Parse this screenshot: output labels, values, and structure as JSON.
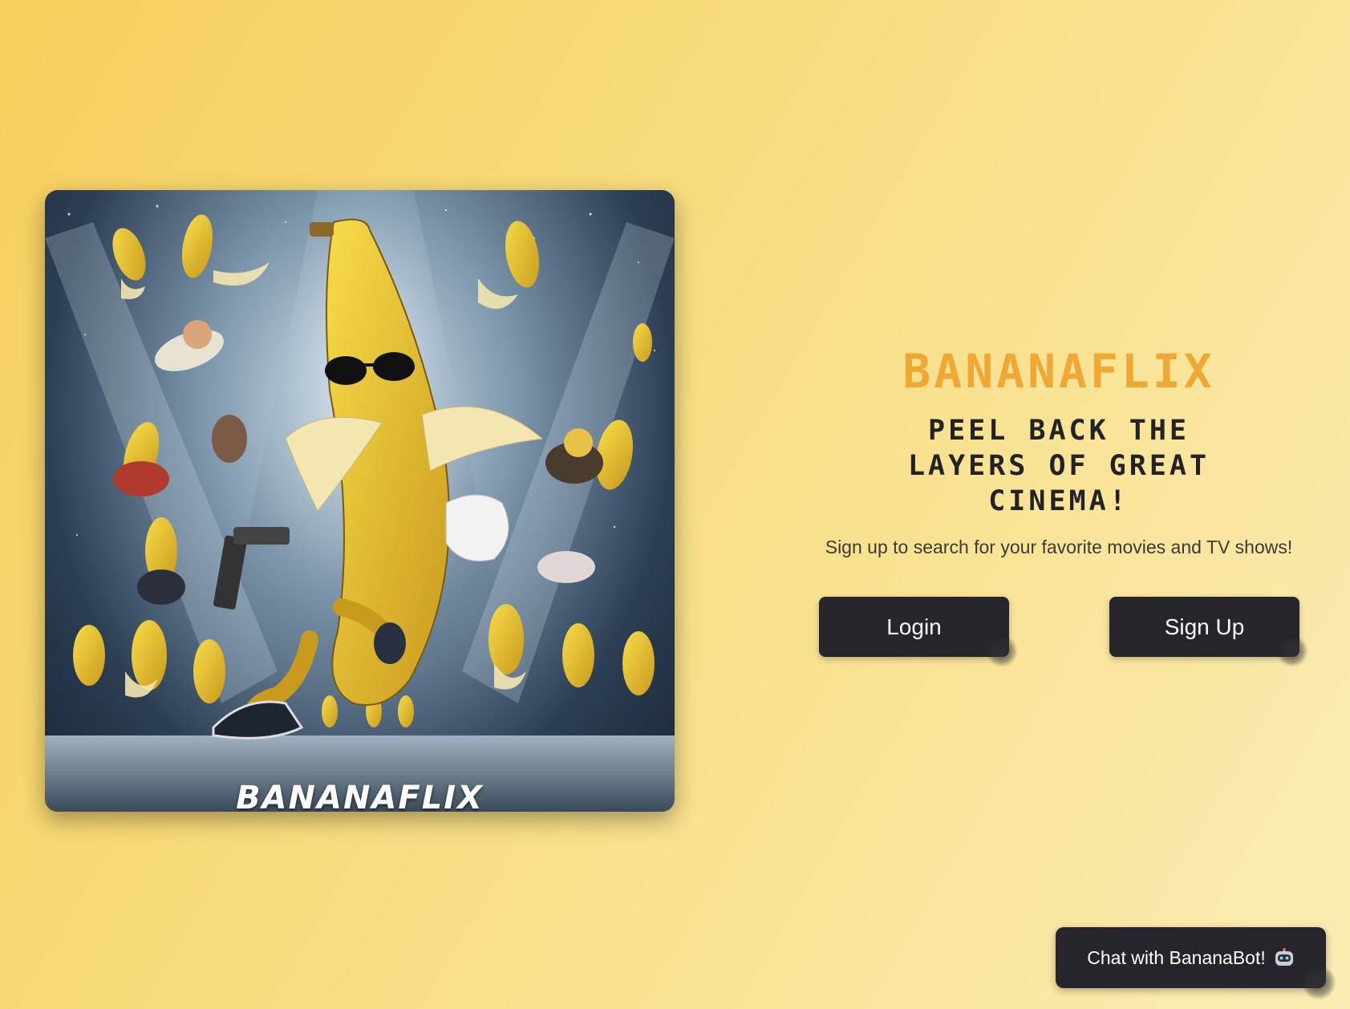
{
  "poster": {
    "alt": "Bananaflix poster with a banana in sunglasses leading flying banana characters",
    "wordmark": "BANANAFLIX"
  },
  "hero": {
    "brand": "BANANAFLIX",
    "tagline": "PEEL BACK THE LAYERS OF GREAT CINEMA!",
    "subtext": "Sign up to search for your favorite movies and TV shows!"
  },
  "actions": {
    "login_label": "Login",
    "signup_label": "Sign Up"
  },
  "chat": {
    "label": "Chat with BananaBot!",
    "icon": "robot-icon"
  },
  "colors": {
    "brand": "#f0a733",
    "button_bg": "#25252b",
    "tagline": "#232326"
  }
}
